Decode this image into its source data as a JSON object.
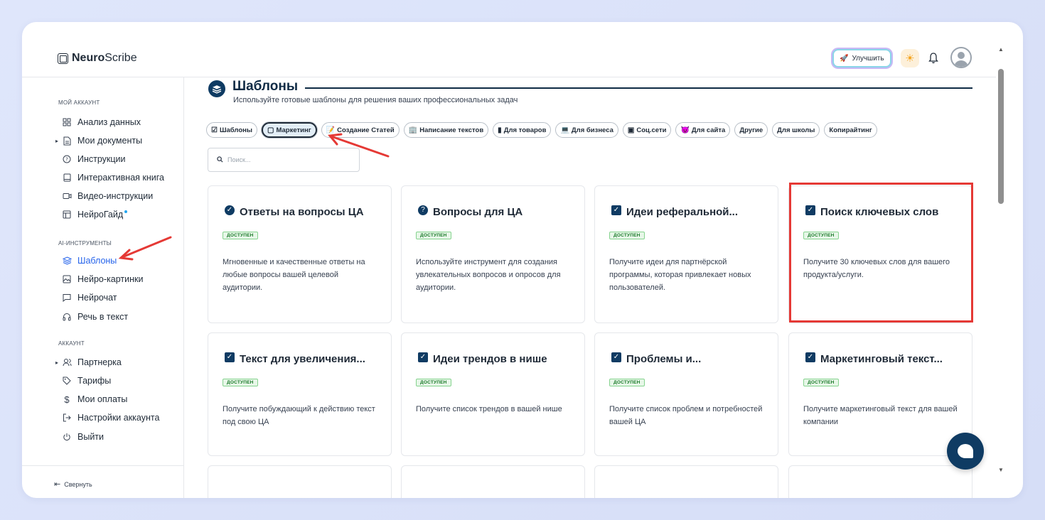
{
  "logo": {
    "bold": "Neuro",
    "rest": "Scribe"
  },
  "header": {
    "upgrade_label": "Улучшить"
  },
  "sidebar": {
    "section_account": "МОЙ АККАУНТ",
    "account_items": [
      {
        "label": "Анализ данных",
        "icon": "grid-icon"
      },
      {
        "label": "Мои документы",
        "icon": "document-icon"
      },
      {
        "label": "Инструкции",
        "icon": "question-circle-icon"
      },
      {
        "label": "Интерактивная книга",
        "icon": "book-icon"
      },
      {
        "label": "Видео-инструкции",
        "icon": "video-icon"
      },
      {
        "label": "НейроГайд",
        "icon": "guide-icon"
      }
    ],
    "section_ai": "AI-ИНСТРУМЕНТЫ",
    "ai_items": [
      {
        "label": "Шаблоны",
        "icon": "layers-icon"
      },
      {
        "label": "Нейро-картинки",
        "icon": "image-icon"
      },
      {
        "label": "Нейрочат",
        "icon": "chat-icon"
      },
      {
        "label": "Речь в текст",
        "icon": "headphones-icon"
      }
    ],
    "section_user": "АККАУНТ",
    "user_items": [
      {
        "label": "Партнерка",
        "icon": "users-icon"
      },
      {
        "label": "Тарифы",
        "icon": "tag-icon"
      },
      {
        "label": "Мои оплаты",
        "icon": "dollar-icon"
      },
      {
        "label": "Настройки аккаунта",
        "icon": "login-icon"
      },
      {
        "label": "Выйти",
        "icon": "power-icon"
      }
    ],
    "collapse_label": "Свернуть"
  },
  "main": {
    "title": "Шаблоны",
    "subtitle": "Используйте готовые шаблоны для решения ваших профессиональных задач",
    "search_placeholder": "Поиск...",
    "chips": [
      {
        "label": "Шаблоны",
        "emoji": "☑"
      },
      {
        "label": "Маркетинг",
        "emoji": "▢"
      },
      {
        "label": "Создание Статей",
        "emoji": "📝"
      },
      {
        "label": "Написание текстов",
        "emoji": "🏢"
      },
      {
        "label": "Для товаров",
        "emoji": "▮"
      },
      {
        "label": "Для бизнеса",
        "emoji": "💻"
      },
      {
        "label": "Соц.сети",
        "emoji": "▣"
      },
      {
        "label": "Для сайта",
        "emoji": "😈"
      },
      {
        "label": "Другие",
        "emoji": ""
      },
      {
        "label": "Для школы",
        "emoji": ""
      },
      {
        "label": "Копирайтинг",
        "emoji": ""
      }
    ],
    "badge_label": "ДОСТУПЕН",
    "cards": [
      {
        "title": "Ответы на вопросы ЦА",
        "desc": "Мгновенные и качественные ответы на любые вопросы вашей целевой аудитории."
      },
      {
        "title": "Вопросы для ЦА",
        "desc": "Используйте инструмент для создания увлекательных вопросов и опросов для аудитории."
      },
      {
        "title": "Идеи реферальной...",
        "desc": "Получите идеи для партнёрской программы, которая привлекает новых пользователей."
      },
      {
        "title": "Поиск ключевых слов",
        "desc": "Получите 30 ключевых слов для вашего продукта/услуги."
      },
      {
        "title": "Текст для увеличения...",
        "desc": "Получите побуждающий к действию текст под свою ЦА"
      },
      {
        "title": "Идеи трендов в нише",
        "desc": "Получите список трендов в вашей нише"
      },
      {
        "title": "Проблемы и...",
        "desc": "Получите список проблем и потребностей вашей ЦА"
      },
      {
        "title": "Маркетинговый текст...",
        "desc": "Получите маркетинговый текст для вашей компании"
      }
    ]
  },
  "colors": {
    "accent": "#0f3b63",
    "active_link": "#2563eb",
    "highlight": "#e53935",
    "badge_bg": "#e7f7e8"
  }
}
